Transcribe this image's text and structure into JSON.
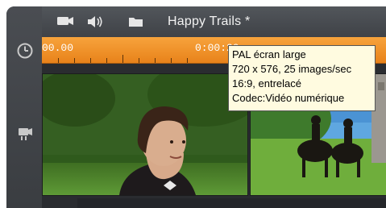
{
  "window": {
    "title": "Happy Trails *"
  },
  "toolbar": {
    "icons": [
      "camera-icon",
      "speaker-icon",
      "folder-icon"
    ]
  },
  "left_rail": {
    "icons": [
      "clock-icon",
      "camera-track-icon"
    ]
  },
  "ruler": {
    "start_time": "00.00",
    "mid_time": "0:00:20"
  },
  "tooltip": {
    "lines": [
      "PAL écran large",
      "720 x 576, 25 images/sec",
      "16:9, entrelacé",
      "Codec:Vidéo numérique"
    ]
  },
  "colors": {
    "ruler_orange": "#f29430",
    "window_dark": "#3b3e43",
    "tooltip_bg": "#fffbe0"
  }
}
